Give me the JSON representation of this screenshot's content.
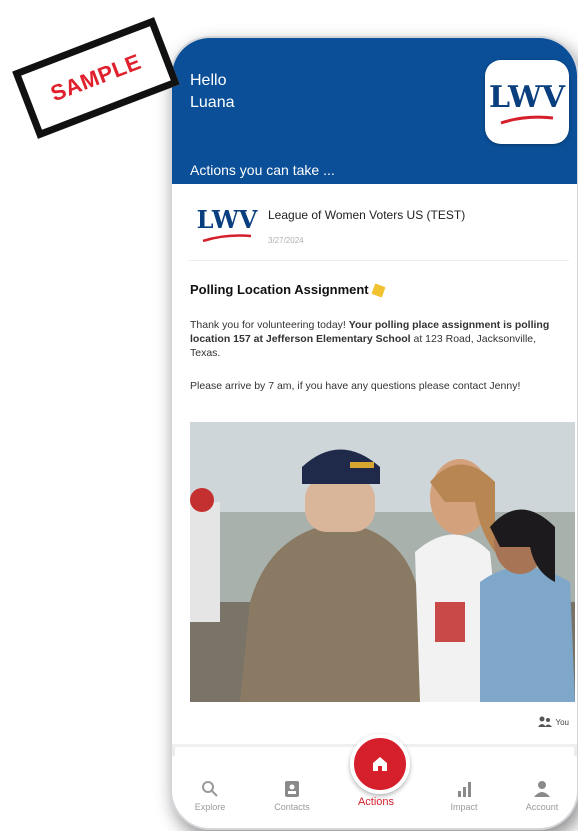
{
  "stamp": {
    "label": "SAMPLE"
  },
  "header": {
    "greeting": "Hello",
    "user_name": "Luana",
    "section_title": "Actions you can take ...",
    "logo_text": "LWV"
  },
  "post": {
    "org_logo_text": "LWV",
    "org_name": "League of Women Voters US (TEST)",
    "date": "3/27/2024",
    "title": "Polling Location Assignment",
    "body_intro": "Thank you for volunteering today! ",
    "body_bold": "Your polling place assignment is polling location 157 at Jefferson Elementary School",
    "body_tail": " at 123 Road, Jacksonville, Texas.",
    "body_second": "Please arrive by 7 am, if you have any questions please contact Jenny!",
    "share_label": "You"
  },
  "tabbar": {
    "tabs": [
      {
        "label": "Explore",
        "icon": "search-icon"
      },
      {
        "label": "Contacts",
        "icon": "contacts-icon"
      },
      {
        "label": "Actions",
        "icon": "home-icon"
      },
      {
        "label": "Impact",
        "icon": "bar-chart-icon"
      },
      {
        "label": "Account",
        "icon": "user-icon"
      }
    ]
  },
  "colors": {
    "header_blue": "#0a4f97",
    "accent_red": "#d51f2b"
  }
}
